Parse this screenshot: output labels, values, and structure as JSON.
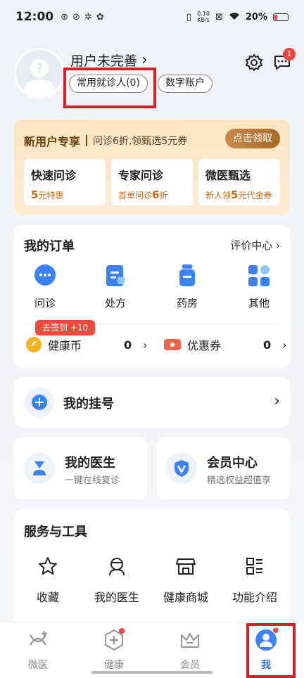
{
  "status_bar": {
    "time": "12:00",
    "net_speed_value": "0.10",
    "net_speed_unit": "KB/s",
    "battery": "20%"
  },
  "profile": {
    "username": "用户未完善",
    "chevron": "›",
    "chip_patients": "常用就诊人(0)",
    "chip_account": "数字账户",
    "message_badge": "1"
  },
  "promo": {
    "title": "新用户专享",
    "subtitle": "问诊6折,领甄选5元券",
    "button": "点击领取",
    "cards": [
      {
        "title": "快速问诊",
        "prefix": "",
        "num": "5",
        "suffix": "元特惠"
      },
      {
        "title": "专家问诊",
        "prefix": "首单问诊",
        "num": "6",
        "suffix": "折"
      },
      {
        "title": "微医甄选",
        "prefix": "新人领",
        "num": "5",
        "suffix": "元代金券"
      }
    ]
  },
  "orders": {
    "title": "我的订单",
    "link": "评价中心",
    "items": [
      "问诊",
      "处方",
      "药房",
      "其他"
    ],
    "sign_tag": "去签到 +10",
    "coins_label": "健康币",
    "coins_value": "0",
    "coupons_label": "优惠券",
    "coupons_value": "0"
  },
  "guahao": {
    "label": "我的挂号"
  },
  "doctor_card": {
    "title": "我的医生",
    "subtitle": "一键在线复诊"
  },
  "vip_card": {
    "title": "会员中心",
    "subtitle": "精选权益超值享"
  },
  "tools": {
    "title": "服务与工具",
    "items": [
      "收藏",
      "我的医生",
      "健康商城",
      "功能介绍"
    ]
  },
  "tabbar": {
    "tabs": [
      "微医",
      "健康",
      "会员",
      "我"
    ],
    "active_color": "#2e6ff0"
  },
  "colors": {
    "accent": "#2e6ff0",
    "highlight": "#d8202a",
    "promo_text": "#c86b14"
  }
}
